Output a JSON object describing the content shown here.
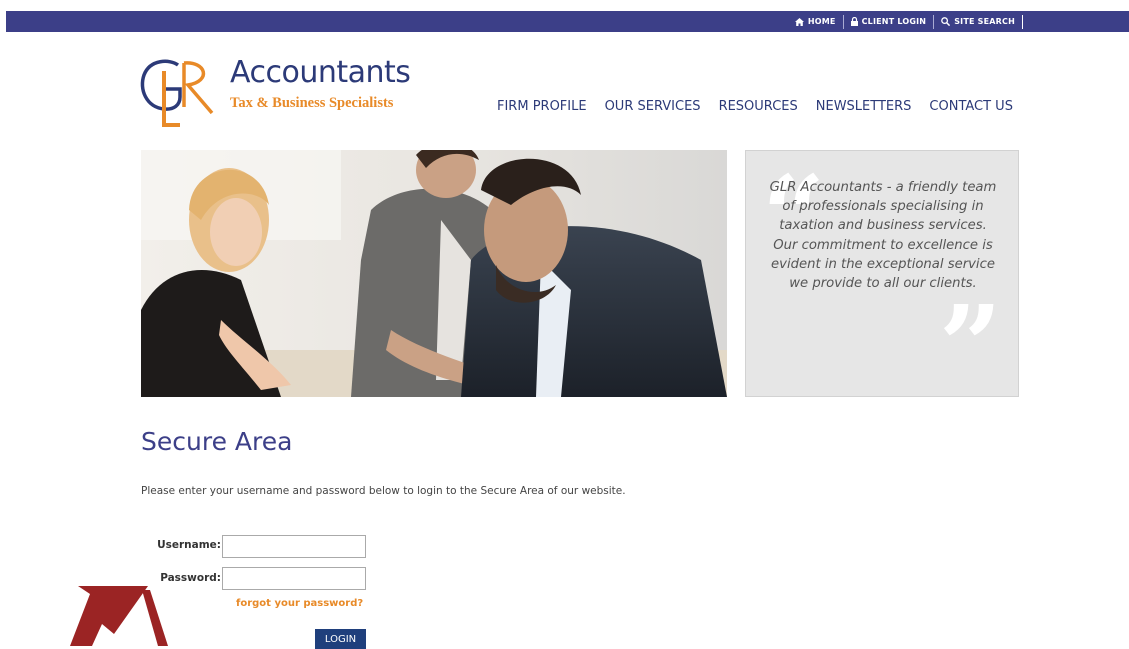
{
  "topbar": {
    "links": [
      {
        "icon": "home-icon",
        "label": "HOME"
      },
      {
        "icon": "lock-icon",
        "label": "CLIENT LOGIN"
      },
      {
        "icon": "search-icon",
        "label": "SITE SEARCH"
      }
    ]
  },
  "logo": {
    "title": "Accountants",
    "subtitle": "Tax & Business Specialists",
    "mark_letters": "GLR"
  },
  "nav": [
    "FIRM PROFILE",
    "OUR SERVICES",
    "RESOURCES",
    "NEWSLETTERS",
    "CONTACT US"
  ],
  "quote": {
    "text": "GLR Accountants - a friendly team of professionals specialising in taxation and business services. Our commitment to excellence is evident in the exceptional service we provide to all our clients."
  },
  "page": {
    "title": "Secure Area",
    "intro": "Please enter your username and password below to login to the Secure Area of our website."
  },
  "form": {
    "username_label": "Username:",
    "username_value": "",
    "password_label": "Password:",
    "password_value": "",
    "forgot": "forgot your password?",
    "login": "LOGIN"
  },
  "colors": {
    "brand_blue": "#3c3f88",
    "brand_orange": "#e88a28",
    "button_blue": "#1f3f7c",
    "arrow_red": "#9b2424"
  }
}
